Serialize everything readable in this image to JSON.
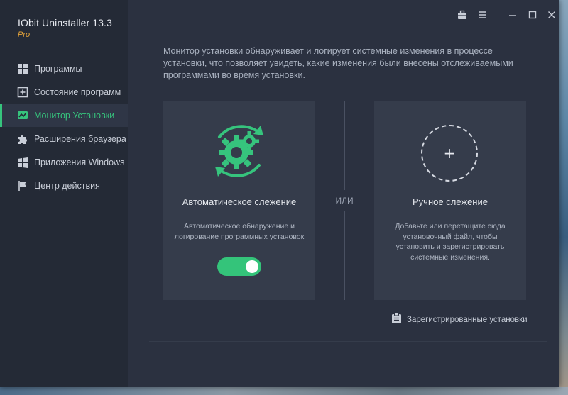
{
  "app": {
    "title": "IObit Uninstaller 13.3",
    "edition": "Pro"
  },
  "titlebar": {
    "icons": [
      "toolbox-icon",
      "menu-icon",
      "minimize-icon",
      "maximize-icon",
      "close-icon"
    ]
  },
  "sidebar": {
    "items": [
      {
        "label": "Программы",
        "icon": "grid-icon",
        "active": false
      },
      {
        "label": "Состояние программ",
        "icon": "plus-square-icon",
        "active": false
      },
      {
        "label": "Монитор Установки",
        "icon": "monitor-chart-icon",
        "active": true
      },
      {
        "label": "Расширения браузера",
        "icon": "puzzle-icon",
        "active": false
      },
      {
        "label": "Приложения Windows",
        "icon": "windows-icon",
        "active": false
      },
      {
        "label": "Центр действия",
        "icon": "flag-icon",
        "active": false
      }
    ]
  },
  "main": {
    "intro": "Монитор установки обнаруживает и логирует системные изменения в процессе установки, что позволяет увидеть, какие изменения были внесены отслеживаемыми программами во время установки.",
    "auto_card": {
      "title": "Автоматическое слежение",
      "description": "Автоматическое обнаружение и логирование программных установок",
      "toggle_on": true
    },
    "or_label": "ИЛИ",
    "manual_card": {
      "title": "Ручное слежение",
      "description": "Добавьте или перетащите сюда установочный файл, чтобы установить и зарегистрировать системные изменения.",
      "plus": "+"
    },
    "registered_link": "Зарегистрированные установки"
  },
  "colors": {
    "accent": "#36c47d",
    "edition": "#e5a43a",
    "window_bg": "#2b3140",
    "sidebar_bg": "#242a36",
    "card_bg": "#353c4b"
  }
}
